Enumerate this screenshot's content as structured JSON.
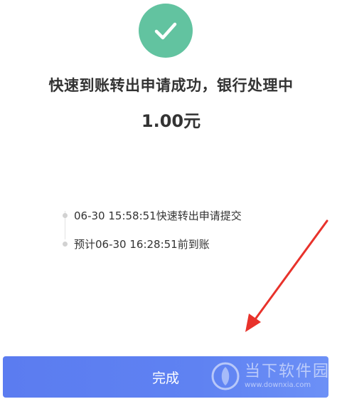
{
  "status": {
    "title": "快速到账转出申请成功，银行处理中",
    "amount": "1.00元",
    "accent_color": "#62c3a0"
  },
  "timeline": {
    "items": [
      {
        "text": "06-30 15:58:51快速转出申请提交"
      },
      {
        "text": "预计06-30 16:28:51前到账"
      }
    ]
  },
  "footer": {
    "done_label": "完成",
    "button_color": "#5b7cf0"
  },
  "watermark": {
    "name": "当下软件园",
    "url": "www.downxia.com"
  },
  "annotation": {
    "arrow_color": "#e8322b"
  }
}
